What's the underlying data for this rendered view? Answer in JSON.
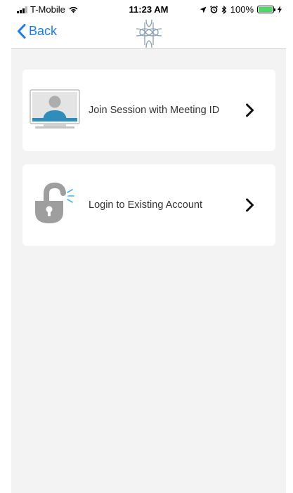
{
  "status_bar": {
    "carrier": "T-Mobile",
    "time": "11:23 AM",
    "battery": "100%",
    "battery_level": 1.0,
    "battery_color": "#4cd964"
  },
  "nav": {
    "back_label": "Back",
    "back_icon": "chevron-left-icon",
    "logo_icon": "knot-logo-icon",
    "accent_color": "#1a7cf2"
  },
  "options": [
    {
      "label": "Join Session with Meeting ID",
      "icon": "monitor-user-icon"
    },
    {
      "label": "Login to Existing Account",
      "icon": "unlocked-padlock-icon"
    }
  ]
}
